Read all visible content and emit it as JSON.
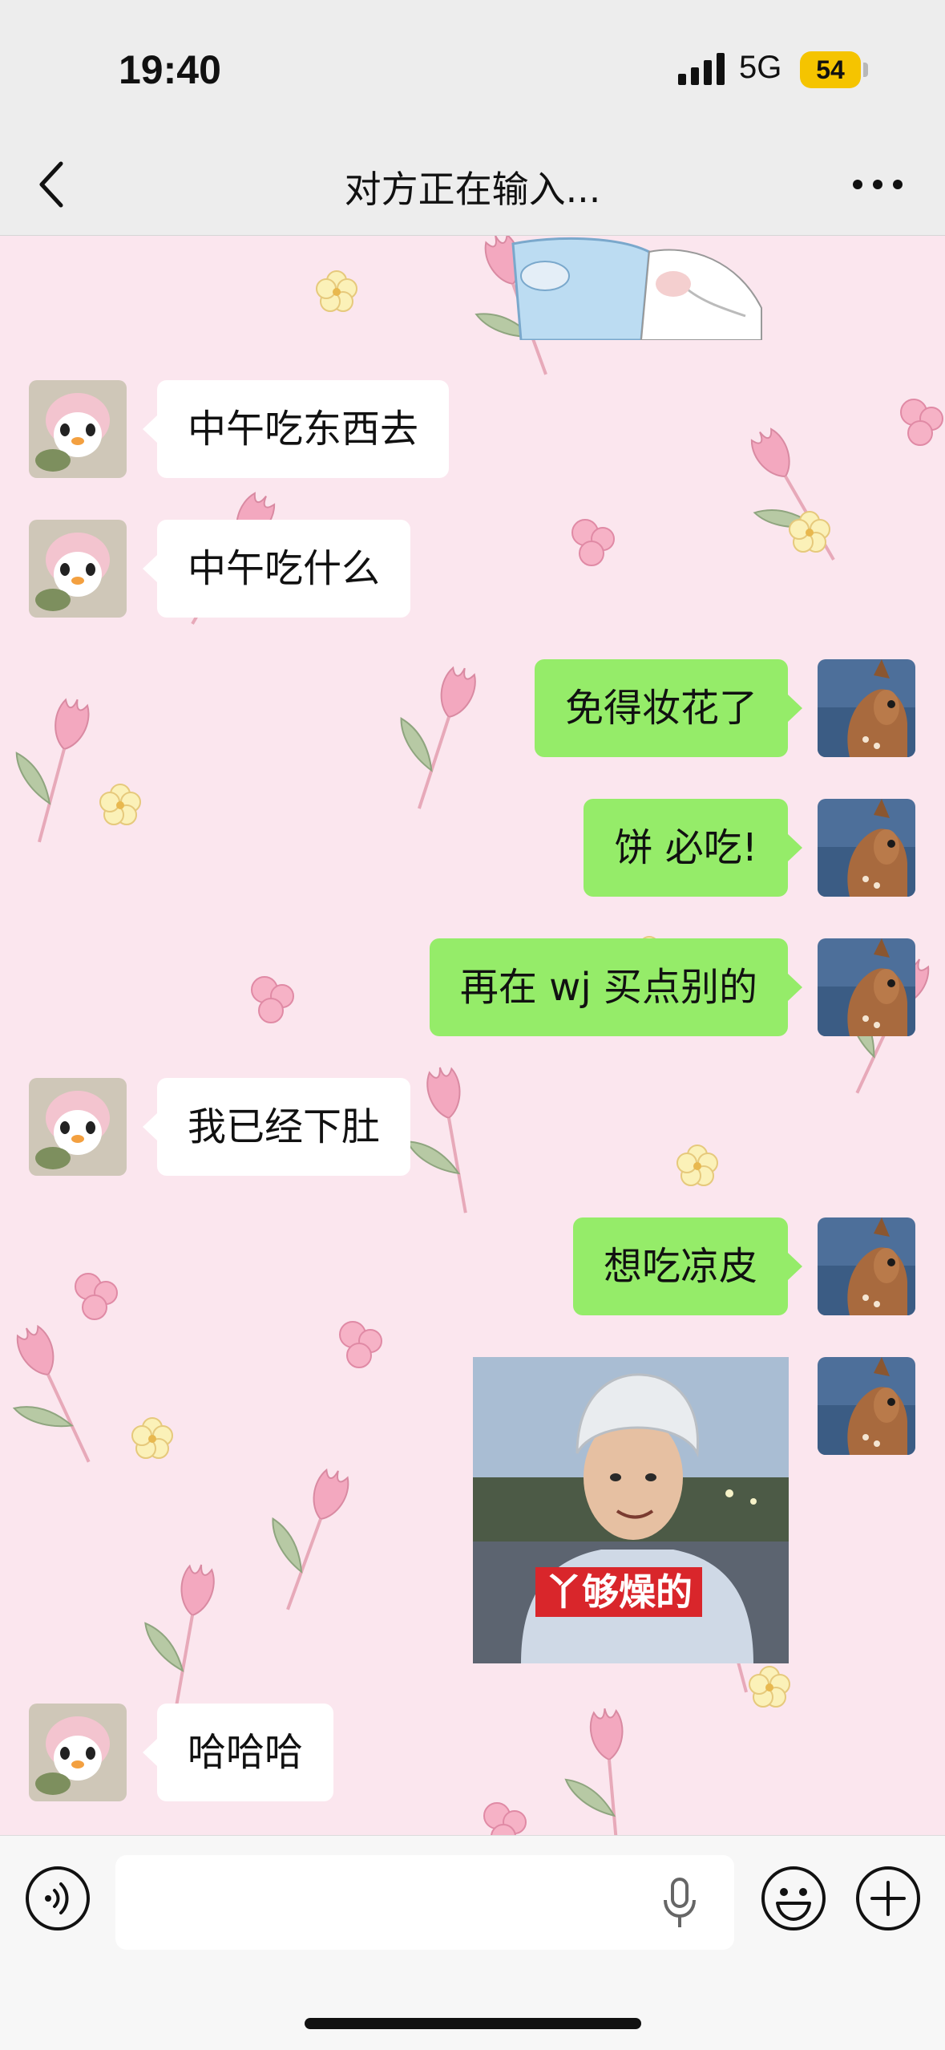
{
  "status_bar": {
    "time": "19:40",
    "network": "5G",
    "battery": "54",
    "battery_color": "#f5c400"
  },
  "header": {
    "title": "对方正在输入...",
    "back_icon": "chevron-left-icon",
    "more_icon": "more-horizontal-icon"
  },
  "colors": {
    "chat_background": "#fbe6ee",
    "received_bubble": "#ffffff",
    "sent_bubble": "#95ec69"
  },
  "messages": [
    {
      "side": "received",
      "type": "text",
      "text": "中午吃东西去"
    },
    {
      "side": "received",
      "type": "text",
      "text": "中午吃什么"
    },
    {
      "side": "sent",
      "type": "text",
      "text": "免得妆花了"
    },
    {
      "side": "sent",
      "type": "text",
      "text": "饼 必吃!"
    },
    {
      "side": "sent",
      "type": "text",
      "text": "再在 wj 买点别的"
    },
    {
      "side": "received",
      "type": "text",
      "text": "我已经下肚"
    },
    {
      "side": "sent",
      "type": "text",
      "text": "想吃凉皮"
    },
    {
      "side": "sent",
      "type": "sticker",
      "caption": "丫够燥的"
    },
    {
      "side": "received",
      "type": "text",
      "text": "哈哈哈"
    }
  ],
  "input_bar": {
    "placeholder": "",
    "voice_icon": "voice-icon",
    "mic_icon": "microphone-icon",
    "emoji_icon": "emoji-icon",
    "plus_icon": "plus-circle-icon"
  }
}
